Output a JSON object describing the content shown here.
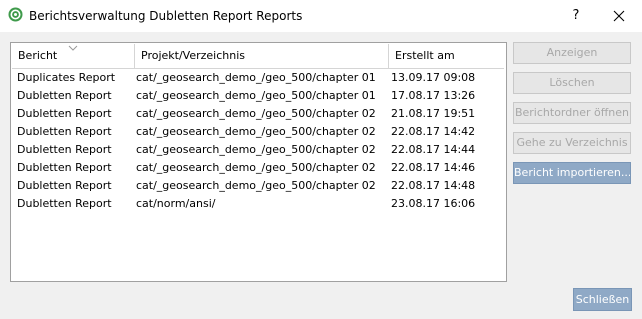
{
  "window": {
    "title": "Berichtsverwaltung Dubletten Report Reports",
    "help_label": "?"
  },
  "table": {
    "headers": {
      "report": "Bericht",
      "project": "Projekt/Verzeichnis",
      "created": "Erstellt am"
    },
    "rows": [
      {
        "report": "Duplicates Report",
        "project": "cat/_geosearch_demo_/geo_500/chapter 01",
        "created": "13.09.17 09:08"
      },
      {
        "report": "Dubletten Report",
        "project": "cat/_geosearch_demo_/geo_500/chapter 01",
        "created": "17.08.17 13:26"
      },
      {
        "report": "Dubletten Report",
        "project": "cat/_geosearch_demo_/geo_500/chapter 02",
        "created": "21.08.17 19:51"
      },
      {
        "report": "Dubletten Report",
        "project": "cat/_geosearch_demo_/geo_500/chapter 02",
        "created": "22.08.17 14:42"
      },
      {
        "report": "Dubletten Report",
        "project": "cat/_geosearch_demo_/geo_500/chapter 02",
        "created": "22.08.17 14:44"
      },
      {
        "report": "Dubletten Report",
        "project": "cat/_geosearch_demo_/geo_500/chapter 02",
        "created": "22.08.17 14:46"
      },
      {
        "report": "Dubletten Report",
        "project": "cat/_geosearch_demo_/geo_500/chapter 02",
        "created": "22.08.17 14:48"
      },
      {
        "report": "Dubletten Report",
        "project": "cat/norm/ansi/",
        "created": "23.08.17 16:06"
      }
    ]
  },
  "buttons": {
    "show": "Anzeigen",
    "delete": "Löschen",
    "open_folder": "Berichtordner öffnen",
    "goto_dir": "Gehe zu Verzeichnis",
    "import": "Bericht importieren...",
    "close": "Schließen"
  },
  "colors": {
    "accent": "#8fa9c6",
    "app_icon": "#3f9a4b",
    "disabled_text": "#a8a8a8"
  },
  "icons": {
    "app": "app-logo-icon",
    "close": "close-icon",
    "sort": "sort-indicator-icon"
  }
}
